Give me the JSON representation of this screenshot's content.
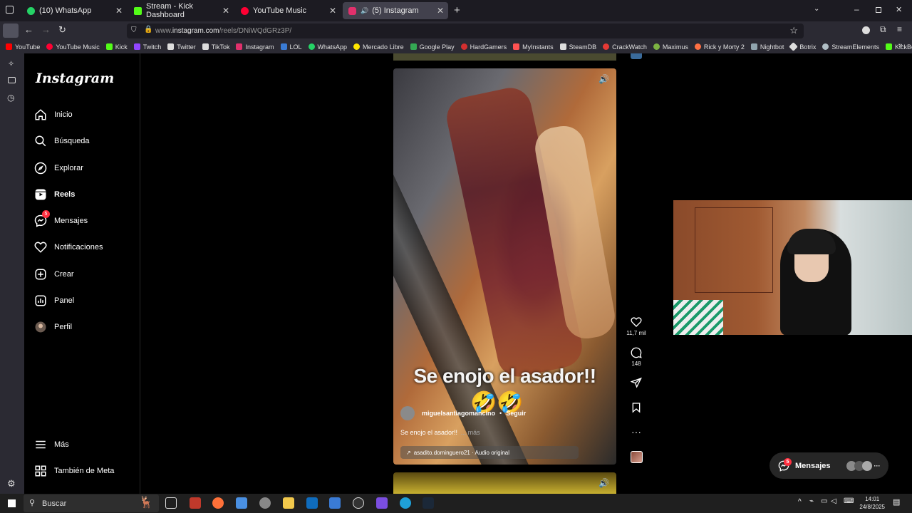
{
  "tabs": [
    {
      "label": "(10) WhatsApp",
      "color": "#25d366"
    },
    {
      "label": "Stream - Kick Dashboard",
      "color": "#53fc18"
    },
    {
      "label": "YouTube Music",
      "color": "#ff0033"
    },
    {
      "label": "(5) Instagram",
      "color": "#e1306c"
    }
  ],
  "url": {
    "prefix": "www.",
    "domain": "instagram.com",
    "path": "/reels/DNiWQdGRz3P/"
  },
  "bookmarks": [
    {
      "label": "YouTube",
      "color": "#ff0000"
    },
    {
      "label": "YouTube Music",
      "color": "#ff0033"
    },
    {
      "label": "Kick",
      "color": "#53fc18"
    },
    {
      "label": "Twitch",
      "color": "#9146ff"
    },
    {
      "label": "Twitter",
      "color": "#ffffff"
    },
    {
      "label": "TikTok",
      "color": "#ffffff"
    },
    {
      "label": "Instagram",
      "color": "#e1306c"
    },
    {
      "label": "LOL",
      "color": "#3a7bd5"
    },
    {
      "label": "WhatsApp",
      "color": "#25d366"
    },
    {
      "label": "Mercado Libre",
      "color": "#ffe600"
    },
    {
      "label": "Google Play",
      "color": "#34a853"
    },
    {
      "label": "HardGamers",
      "color": "#d32f2f"
    },
    {
      "label": "MyInstants",
      "color": "#ff5252"
    },
    {
      "label": "SteamDB",
      "color": "#ffffff"
    },
    {
      "label": "CrackWatch",
      "color": "#e53935"
    },
    {
      "label": "Maximus",
      "color": "#7cb342"
    },
    {
      "label": "Rick y Morty 2",
      "color": "#ff7043"
    },
    {
      "label": "Nightbot",
      "color": "#90a4ae"
    },
    {
      "label": "Botrix",
      "color": "#ffffff"
    },
    {
      "label": "StreamElements",
      "color": "#b0bec5"
    },
    {
      "label": "KickBot",
      "color": "#53fc18"
    }
  ],
  "instagram": {
    "logo": "Instagram",
    "nav": [
      {
        "label": "Inicio",
        "icon": "home-icon"
      },
      {
        "label": "Búsqueda",
        "icon": "search-icon"
      },
      {
        "label": "Explorar",
        "icon": "compass-icon"
      },
      {
        "label": "Reels",
        "icon": "reels-icon"
      },
      {
        "label": "Mensajes",
        "icon": "messenger-icon",
        "badge": "5"
      },
      {
        "label": "Notificaciones",
        "icon": "heart-icon"
      },
      {
        "label": "Crear",
        "icon": "plus-icon"
      },
      {
        "label": "Panel",
        "icon": "chart-icon"
      },
      {
        "label": "Perfil",
        "icon": "avatar-icon"
      }
    ],
    "bottom_nav": [
      {
        "label": "Más",
        "icon": "menu-icon"
      },
      {
        "label": "También de Meta",
        "icon": "meta-icon"
      }
    ]
  },
  "reel": {
    "overlay_text": "Se enojo el asador!!",
    "emoji": "🤣🤣",
    "username": "miguelsantiagomancino",
    "follow": "Seguir",
    "caption": "Se enojo el asador!!",
    "more": "... más",
    "audio": "asadito.dominguero21 · Audio original",
    "likes": "11,7 mil",
    "comments": "148"
  },
  "messages_pill": {
    "label": "Mensajes",
    "badge": "5"
  },
  "taskbar": {
    "search_placeholder": "Buscar",
    "time": "14:01",
    "date": "24/8/2025"
  }
}
